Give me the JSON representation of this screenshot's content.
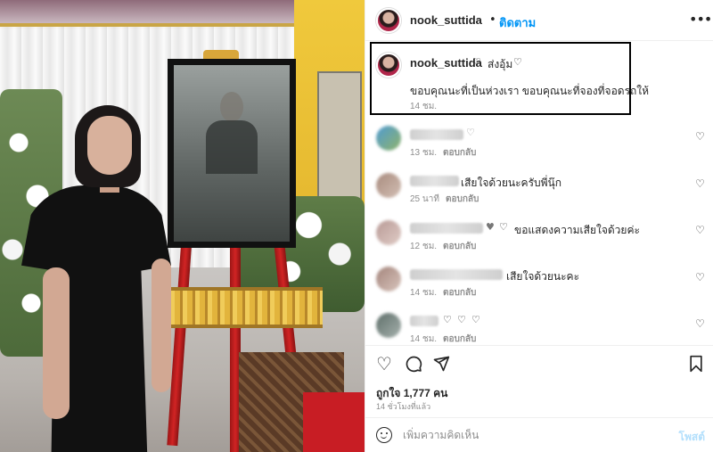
{
  "post": {
    "username": "nook_suttida",
    "separator": "•",
    "follow_label": "ติดตาม",
    "more_icon": "more-horizontal-icon"
  },
  "caption": {
    "username": "nook_suttida",
    "heart_icon": "heart-outline-icon",
    "tag": "ส่งอุ้ม",
    "text": "ขอบคุณนะที่เป็นห่วงเรา ขอบคุณนะที่จองที่จอดรถให้",
    "time": "14 ชม."
  },
  "comments": [
    {
      "time": "13 ชม.",
      "reply": "ตอบกลับ",
      "text": ""
    },
    {
      "time": "25 นาที",
      "reply": "ตอบกลับ",
      "text": "เสียใจด้วยนะครับพี่นุ๊ก"
    },
    {
      "time": "12 ชม.",
      "reply": "ตอบกลับ",
      "text": "ขอแสดงความเสียใจด้วยค่ะ"
    },
    {
      "time": "14 ชม.",
      "reply": "ตอบกลับ",
      "text": "เสียใจด้วยนะคะ"
    },
    {
      "time": "14 ชม.",
      "reply": "ตอบกลับ",
      "text": ""
    }
  ],
  "actions": {
    "like_icon": "heart-icon",
    "comment_icon": "comment-icon",
    "share_icon": "share-icon",
    "save_icon": "bookmark-icon",
    "likes": "ถูกใจ 1,777 คน",
    "posted": "14 ชั่วโมงที่แล้ว"
  },
  "comment_bar": {
    "emoji_icon": "emoji-icon",
    "placeholder": "เพิ่มความคิดเห็น",
    "post_label": "โพสต์"
  },
  "colors": {
    "accent": "#0095f6",
    "post_disabled": "#b2dffc",
    "muted": "#8e8e8e"
  }
}
